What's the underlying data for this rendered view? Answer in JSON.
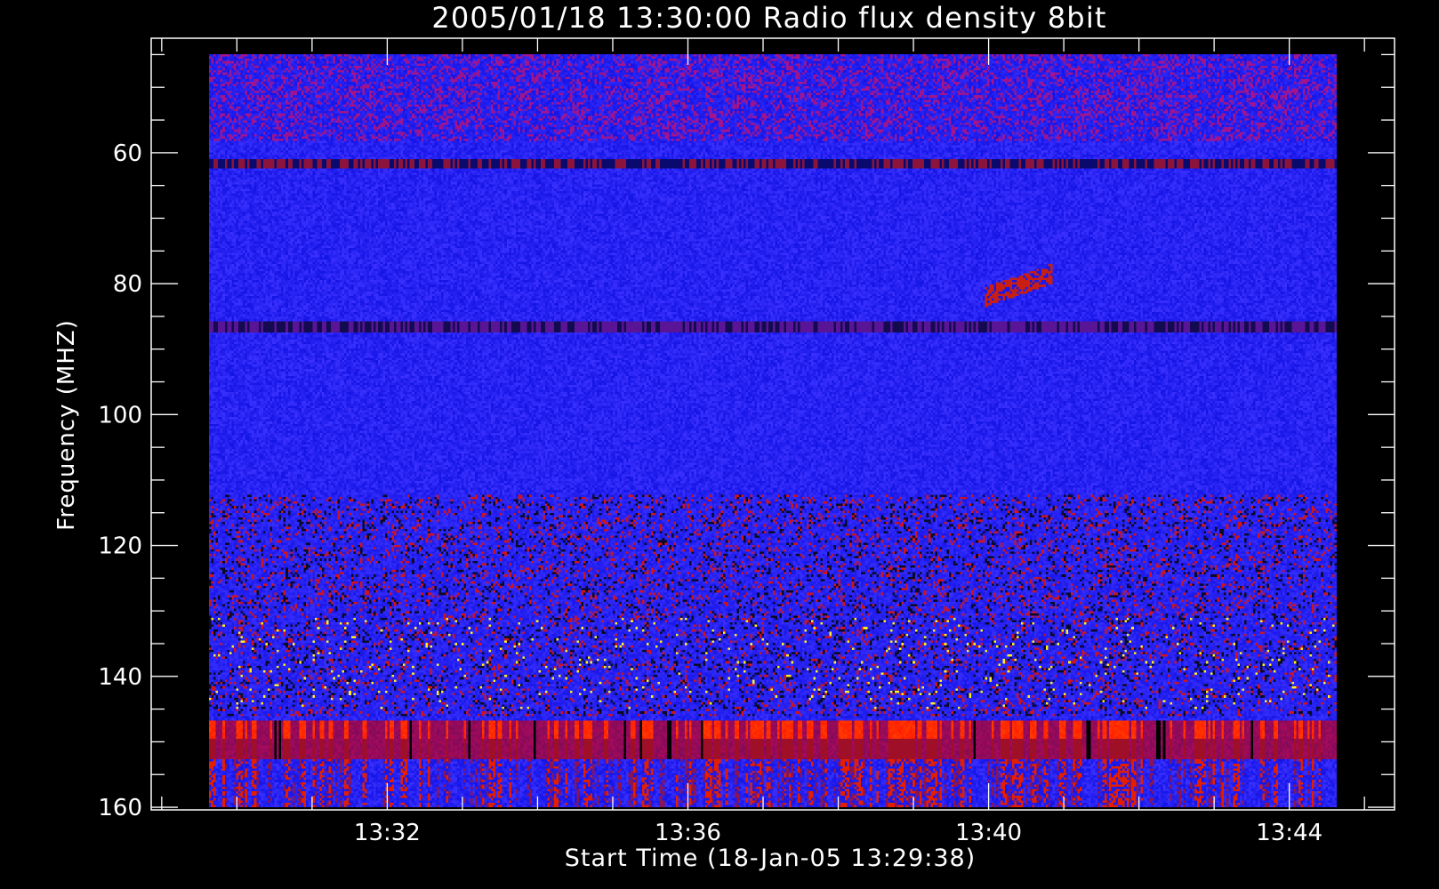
{
  "chart_data": {
    "type": "heatmap",
    "title": "2005/01/18 13:30:00 Radio flux density 8bit",
    "xlabel": "Start Time (18-Jan-05 13:29:38)",
    "ylabel": "Frequency (MHZ)",
    "x_tick_labels": [
      "13:32",
      "13:36",
      "13:40",
      "13:44"
    ],
    "x_tick_values_min": [
      2.37,
      6.37,
      10.37,
      14.37
    ],
    "x_range_min": [
      -0.77,
      15.77
    ],
    "data_x_range_min": [
      0.0,
      15.0
    ],
    "y_tick_labels": [
      "60",
      "80",
      "100",
      "120",
      "140",
      "160"
    ],
    "y_tick_values": [
      60,
      80,
      100,
      120,
      140,
      160
    ],
    "ylim": [
      160.4,
      42.5
    ],
    "data_y_range": [
      45.0,
      160.0
    ],
    "y_reversed": true,
    "colormap": [
      "#000000",
      "#0000ff",
      "#8b0000",
      "#ff0000",
      "#ffff00"
    ],
    "features": [
      {
        "label": "persistent emission band",
        "freq_range": [
          146.5,
          152.5
        ],
        "value": "high"
      },
      {
        "label": "dark absorption line",
        "freq": 61.5,
        "value": "low"
      },
      {
        "label": "dark absorption line",
        "freq": 86.5,
        "value": "low"
      },
      {
        "label": "burst region",
        "freq_range": [
          112,
          146
        ],
        "value": "mixed"
      },
      {
        "label": "drifting feature",
        "time_min": 10.6,
        "freq": 80,
        "value": "medium"
      }
    ]
  },
  "colors": {
    "background": "#000000",
    "foreground": "#ffffff",
    "base_blue": "#1a1aff",
    "dark_red": "#8b0000",
    "bright_red": "#ff1a00",
    "yellow": "#ffb000"
  }
}
